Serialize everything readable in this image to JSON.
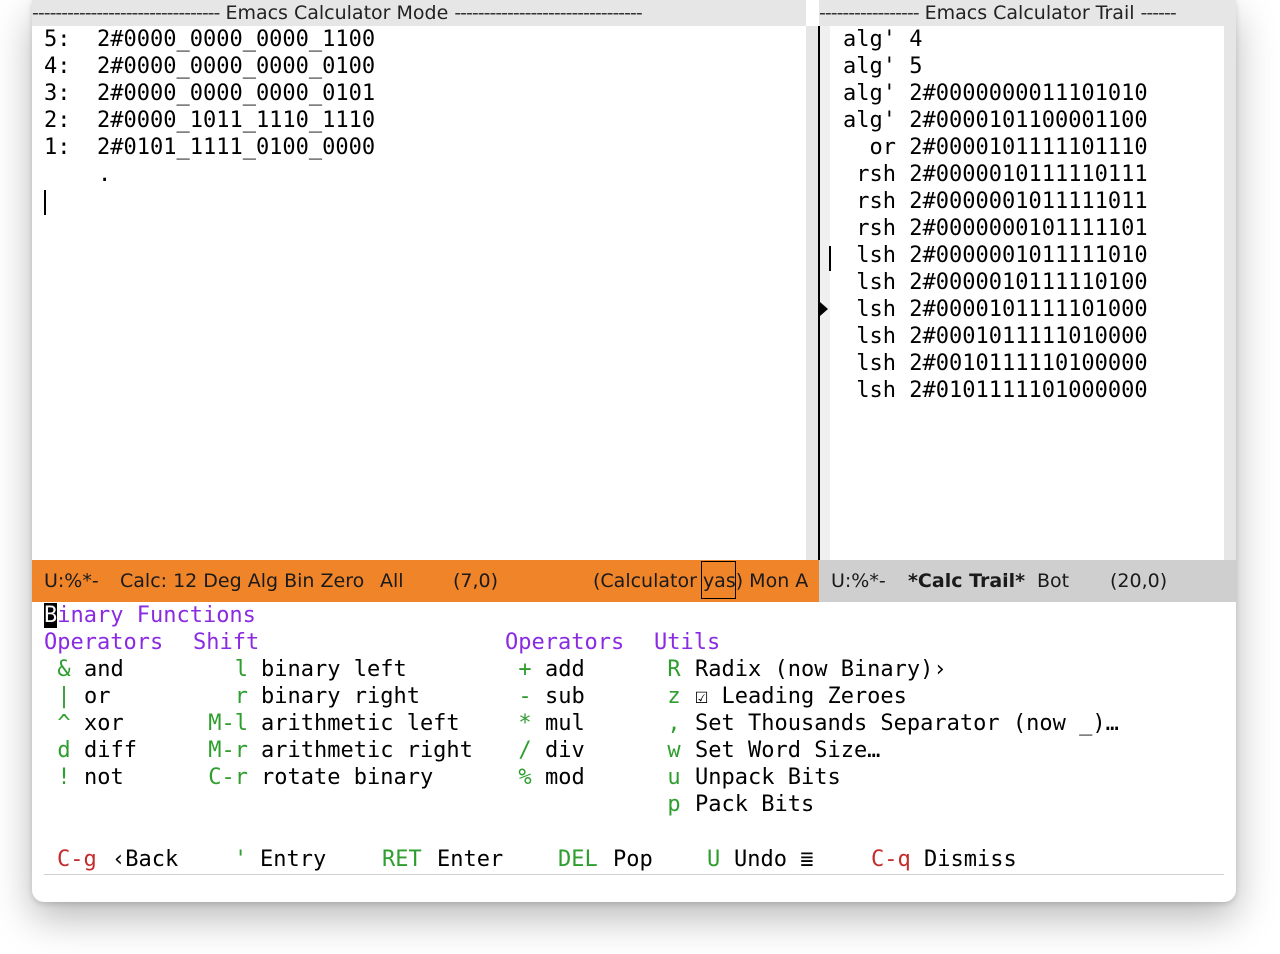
{
  "headers": {
    "left_title": "Emacs Calculator Mode",
    "right_title": "Emacs Calculator Trail"
  },
  "stack": [
    {
      "label": "5:",
      "value": "2#0000_0000_0000_1100"
    },
    {
      "label": "4:",
      "value": "2#0000_0000_0000_0100"
    },
    {
      "label": "3:",
      "value": "2#0000_0000_0000_0101"
    },
    {
      "label": "2:",
      "value": "2#0000_1011_1110_1110"
    },
    {
      "label": "1:",
      "value": "2#0101_1111_0100_0000"
    }
  ],
  "stack_end": ".",
  "trail": [
    {
      "op": "alg'",
      "value": "4"
    },
    {
      "op": "alg'",
      "value": "5"
    },
    {
      "op": "alg'",
      "value": "2#0000000011101010"
    },
    {
      "op": "alg'",
      "value": "2#0000101100001100"
    },
    {
      "op": "or",
      "value": "2#0000101111101110"
    },
    {
      "op": "rsh",
      "value": "2#0000010111110111"
    },
    {
      "op": "rsh",
      "value": "2#0000001011111011"
    },
    {
      "op": "rsh",
      "value": "2#0000000101111101"
    },
    {
      "op": "lsh",
      "value": "2#0000001011111010"
    },
    {
      "op": "lsh",
      "value": "2#0000010111110100"
    },
    {
      "op": "lsh",
      "value": "2#0000101111101000"
    },
    {
      "op": "lsh",
      "value": "2#0001011111010000"
    },
    {
      "op": "lsh",
      "value": "2#0010111110100000"
    },
    {
      "op": "lsh",
      "value": "2#0101111101000000"
    }
  ],
  "modeline_left": {
    "status": "U:%*-",
    "mode": "Calc: 12 Deg Alg Bin Zero",
    "position": "All",
    "coords": "(7,0)",
    "minor_prefix": "(Calculator ",
    "minor_yas": "yas",
    "minor_suffix": ") Mon A"
  },
  "modeline_right": {
    "status": "U:%*-",
    "buffer": "*Calc Trail*",
    "position": "Bot",
    "coords": "(20,0)"
  },
  "transient": {
    "title_first": "B",
    "title_rest": "inary Functions",
    "col1": {
      "heading": "Operators",
      "items": [
        {
          "key": "&",
          "label": "and"
        },
        {
          "key": "|",
          "label": "or"
        },
        {
          "key": "^",
          "label": "xor"
        },
        {
          "key": "d",
          "label": "diff"
        },
        {
          "key": "!",
          "label": "not"
        }
      ]
    },
    "col2": {
      "heading": "Shift",
      "items": [
        {
          "key": "l",
          "label": "binary left"
        },
        {
          "key": "r",
          "label": "binary right"
        },
        {
          "key": "M-l",
          "label": "arithmetic left"
        },
        {
          "key": "M-r",
          "label": "arithmetic right"
        },
        {
          "key": "C-r",
          "label": "rotate binary"
        }
      ]
    },
    "col3": {
      "heading": "Operators",
      "items": [
        {
          "key": "+",
          "label": "add"
        },
        {
          "key": "-",
          "label": "sub"
        },
        {
          "key": "*",
          "label": "mul"
        },
        {
          "key": "/",
          "label": "div"
        },
        {
          "key": "%",
          "label": "mod"
        }
      ]
    },
    "col4": {
      "heading": "Utils",
      "items": [
        {
          "key": "R",
          "label": "Radix (now Binary)›"
        },
        {
          "key": "z",
          "label": "☑ Leading Zeroes"
        },
        {
          "key": ",",
          "label": "Set Thousands Separator (now _)…"
        },
        {
          "key": "w",
          "label": "Set Word Size…"
        },
        {
          "key": "u",
          "label": "Unpack Bits"
        },
        {
          "key": "p",
          "label": "Pack Bits"
        }
      ]
    },
    "footer": [
      {
        "key": "C-g",
        "label": "‹Back",
        "key_color": "red"
      },
      {
        "key": "'",
        "label": "Entry",
        "key_color": "green"
      },
      {
        "key": "RET",
        "label": "Enter",
        "key_color": "green"
      },
      {
        "key": "DEL",
        "label": "Pop",
        "key_color": "green"
      },
      {
        "key": "U",
        "label": "Undo ≣",
        "key_color": "green"
      },
      {
        "key": "C-q",
        "label": "Dismiss",
        "key_color": "red"
      }
    ]
  },
  "colors": {
    "modeline_active": "#f08428",
    "modeline_inactive": "#cfcfcf",
    "heading_purple": "#8a2be2",
    "key_green": "#2e9e2e",
    "key_red": "#c42b2b"
  }
}
